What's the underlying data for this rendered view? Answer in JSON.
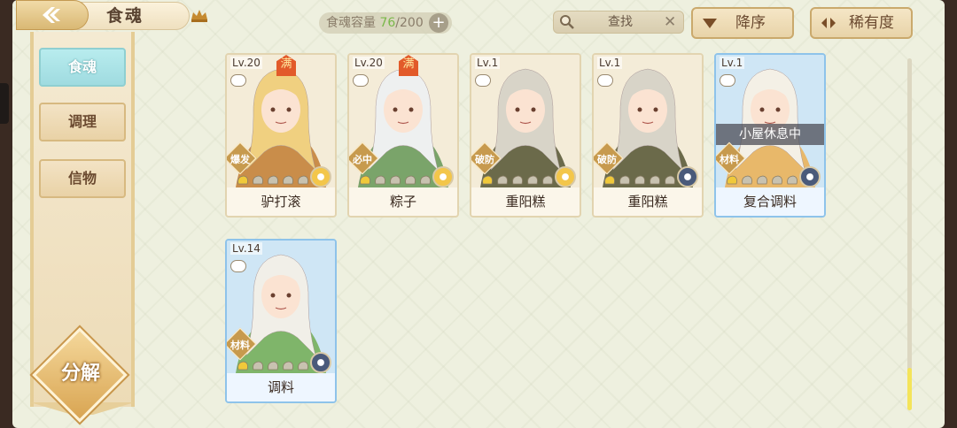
{
  "header": {
    "title": "食魂",
    "capacity_label": "食魂容量",
    "capacity_current": "76",
    "capacity_total": "/200",
    "search_placeholder": "查找",
    "sort_label": "降序",
    "rarity_label": "稀有度"
  },
  "sidebar": {
    "tabs": [
      {
        "label": "食魂"
      },
      {
        "label": "调理"
      },
      {
        "label": "信物"
      }
    ],
    "decompose_label": "分解"
  },
  "cards": [
    {
      "level": "Lv.20",
      "full": "满",
      "tag": "爆发",
      "name": "驴打滚",
      "art_color": "#c98d4a",
      "hair": "#f0d080",
      "emblem": "#f3c64a",
      "emblem_icon": "flower-icon"
    },
    {
      "level": "Lv.20",
      "full": "满",
      "tag": "必中",
      "name": "粽子",
      "art_color": "#7aa46a",
      "hair": "#eef0f0",
      "emblem": "#f3c64a",
      "emblem_icon": "flower-icon"
    },
    {
      "level": "Lv.1",
      "full": "",
      "tag": "破防",
      "name": "重阳糕",
      "art_color": "#6b6a4a",
      "hair": "#d8d4c8",
      "emblem": "#f3c64a",
      "emblem_icon": "flower-icon"
    },
    {
      "level": "Lv.1",
      "full": "",
      "tag": "破防",
      "name": "重阳糕",
      "art_color": "#6b6a4a",
      "hair": "#d8d4c8",
      "emblem": "#4a5a7a",
      "emblem_icon": "gear-flower-icon"
    },
    {
      "level": "Lv.1",
      "full": "",
      "tag": "材料",
      "name": "复合调料",
      "art_color": "#e8b86a",
      "hair": "#f4f0e6",
      "emblem": "#4a5a7a",
      "emblem_icon": "gear-flower-icon",
      "status": "小屋休息中"
    },
    {
      "level": "Lv.14",
      "full": "",
      "tag": "材料",
      "name": "调料",
      "art_color": "#7fb56a",
      "hair": "#f1efe8",
      "emblem": "#4a5a7a",
      "emblem_icon": "gear-flower-icon"
    }
  ]
}
